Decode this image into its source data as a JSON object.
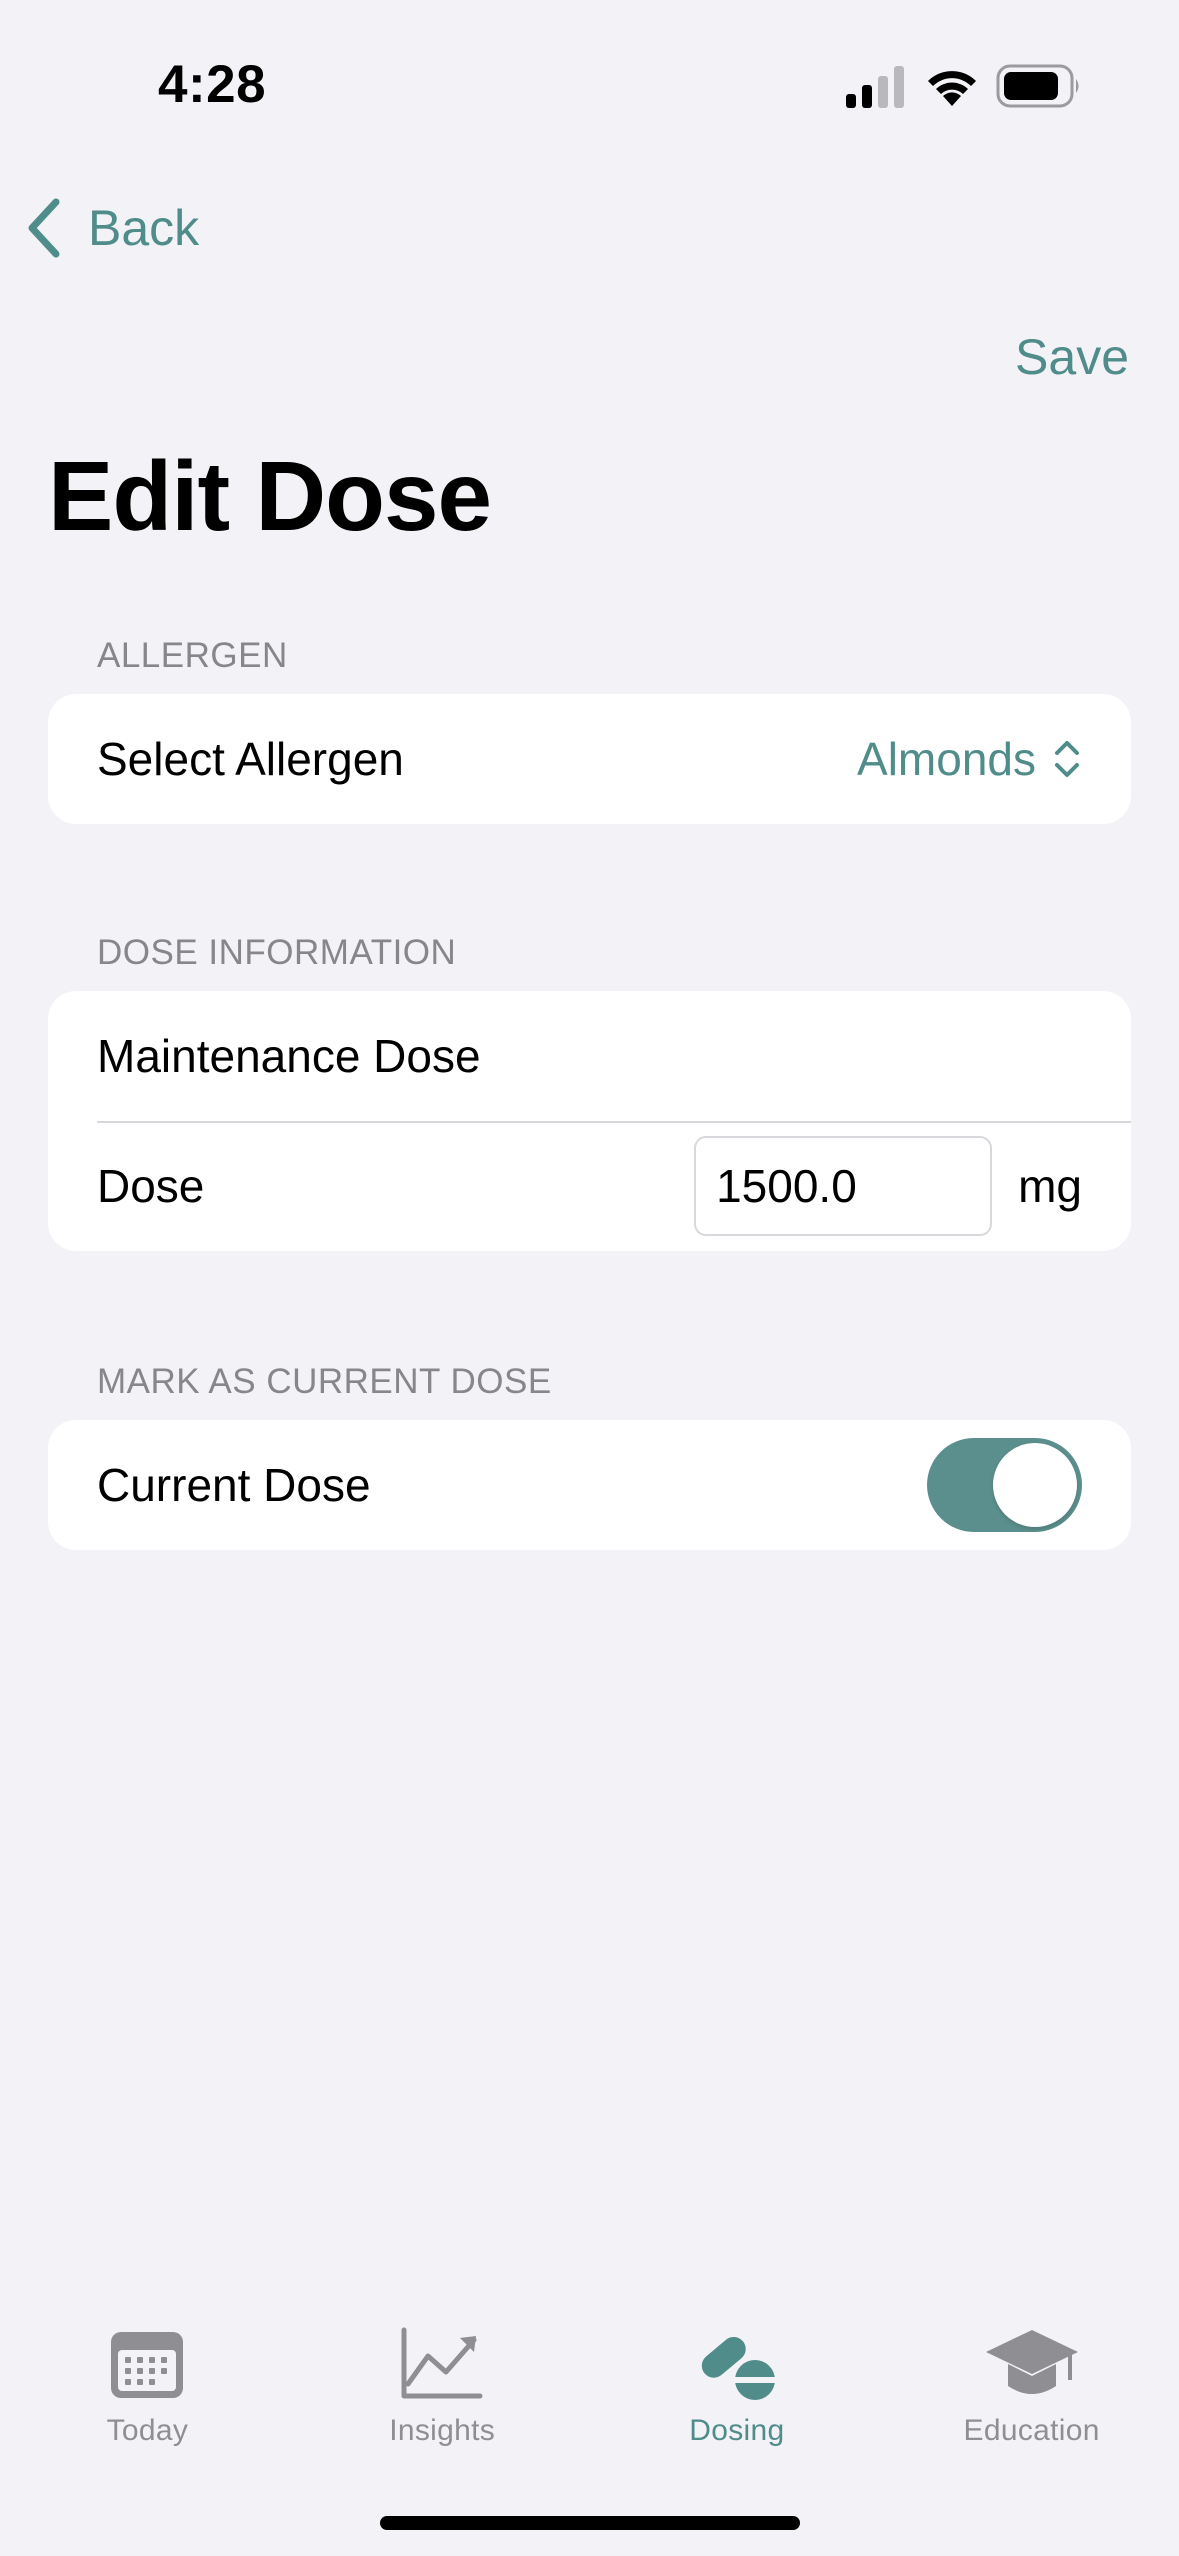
{
  "status_bar": {
    "time": "4:28"
  },
  "nav": {
    "back_label": "Back",
    "save_label": "Save",
    "title": "Edit Dose"
  },
  "colors": {
    "accent": "#4f8c8a",
    "toggle_on": "#5b8f8d",
    "background": "#f2f2f7"
  },
  "sections": {
    "allergen": {
      "header": "ALLERGEN",
      "row_label": "Select Allergen",
      "selected_value": "Almonds",
      "icon": "chevron-up-down-icon"
    },
    "dose_info": {
      "header": "DOSE INFORMATION",
      "dose_type": "Maintenance Dose",
      "dose_label": "Dose",
      "dose_value": "1500.0",
      "unit": "mg"
    },
    "current": {
      "header": "MARK AS CURRENT DOSE",
      "row_label": "Current Dose",
      "toggle_on": true
    }
  },
  "tabs": [
    {
      "label": "Today",
      "icon": "calendar-icon",
      "active": false
    },
    {
      "label": "Insights",
      "icon": "chart-line-icon",
      "active": false
    },
    {
      "label": "Dosing",
      "icon": "pills-icon",
      "active": true
    },
    {
      "label": "Education",
      "icon": "graduation-cap-icon",
      "active": false
    }
  ]
}
